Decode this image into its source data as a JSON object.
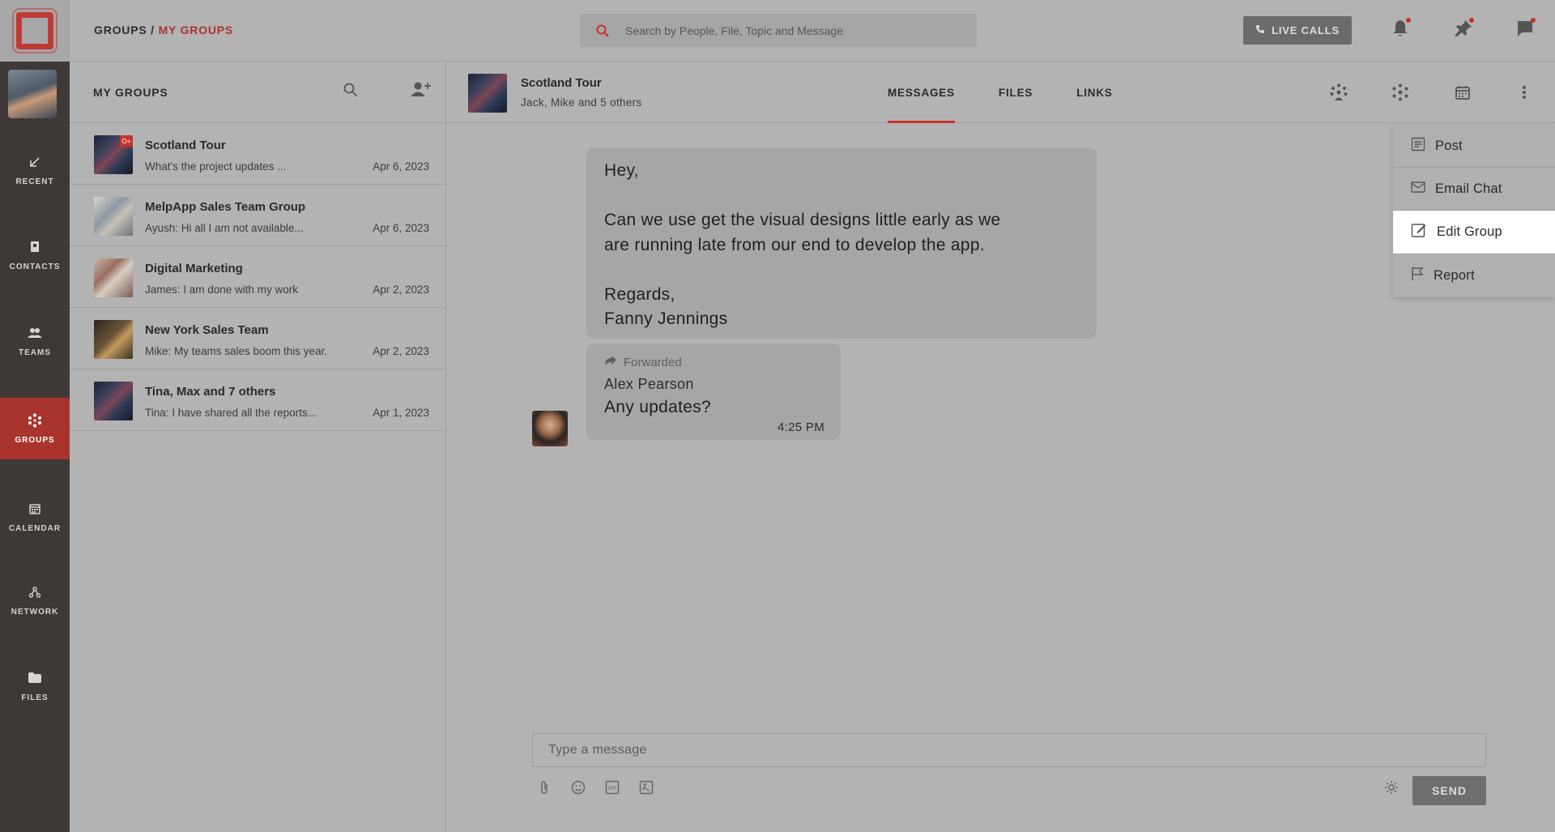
{
  "rail": {
    "items": [
      {
        "label": "RECENT",
        "icon": "arrow-down-left-icon"
      },
      {
        "label": "CONTACTS",
        "icon": "contact-book-icon"
      },
      {
        "label": "TEAMS",
        "icon": "team-icon"
      },
      {
        "label": "GROUPS",
        "icon": "groups-icon",
        "active": true
      },
      {
        "label": "CALENDAR",
        "icon": "calendar-icon"
      },
      {
        "label": "NETWORK",
        "icon": "network-icon"
      },
      {
        "label": "FILES",
        "icon": "folder-icon"
      }
    ]
  },
  "header": {
    "breadcrumb_root": "GROUPS",
    "breadcrumb_sep": " / ",
    "breadcrumb_current": "MY GROUPS",
    "search_placeholder": "Search by People, File, Topic and Message",
    "live_calls_label": "LIVE CALLS"
  },
  "groups_panel": {
    "title": "MY GROUPS",
    "groups": [
      {
        "name": "Scotland Tour",
        "preview": "What's the project updates ...",
        "date": "Apr 6, 2023",
        "badge": "O+"
      },
      {
        "name": "MelpApp Sales Team Group",
        "preview": "Ayush: Hi all I am not available...",
        "date": "Apr 6, 2023"
      },
      {
        "name": "Digital Marketing",
        "preview": "James: I am done with my work",
        "date": "Apr 2, 2023"
      },
      {
        "name": "New York Sales Team",
        "preview": "Mike: My teams sales boom this year.",
        "date": "Apr 2, 2023"
      },
      {
        "name": "Tina, Max and 7 others",
        "preview": "Tina: I have shared all the reports...",
        "date": "Apr 1, 2023"
      }
    ]
  },
  "chat": {
    "name": "Scotland Tour",
    "members": "Jack, Mike and 5 others",
    "tabs": [
      "MESSAGES",
      "FILES",
      "LINKS"
    ],
    "active_tab": "MESSAGES",
    "message": {
      "line1": "Hey,",
      "line2": "Can we use get the visual designs little early as we",
      "line3": "are running late from our end to develop the app.",
      "line4": "Regards,",
      "line5": "Fanny Jennings"
    },
    "forwarded": {
      "label": "Forwarded",
      "sender": "Alex Pearson",
      "text": "Any updates?",
      "time": "4:25 PM"
    },
    "composer_placeholder": "Type a message",
    "send_label": "SEND"
  },
  "menu": {
    "items": [
      {
        "label": "Post",
        "icon": "post-icon"
      },
      {
        "label": "Email Chat",
        "icon": "envelope-icon"
      },
      {
        "label": "Edit Group",
        "icon": "edit-icon",
        "highlighted": true
      },
      {
        "label": "Report",
        "icon": "flag-icon"
      }
    ]
  },
  "colors": {
    "accent": "#c8322b",
    "rail_bg": "#3e3836",
    "overlay_bg": "#b3b3b3"
  }
}
